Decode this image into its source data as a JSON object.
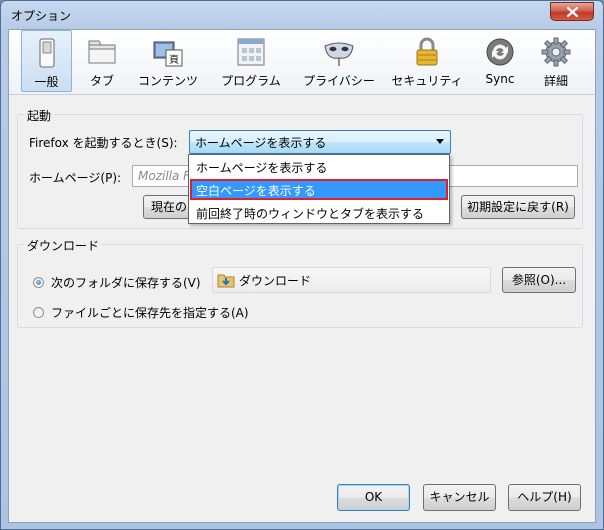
{
  "window": {
    "title": "オプション"
  },
  "toolbar": {
    "items": [
      {
        "label": "一般",
        "icon": "switch-icon",
        "selected": true
      },
      {
        "label": "タブ",
        "icon": "tabs-icon"
      },
      {
        "label": "コンテンツ",
        "icon": "content-icon"
      },
      {
        "label": "プログラム",
        "icon": "applications-icon"
      },
      {
        "label": "プライバシー",
        "icon": "privacy-mask-icon"
      },
      {
        "label": "セキュリティ",
        "icon": "padlock-icon"
      },
      {
        "label": "Sync",
        "icon": "sync-icon"
      },
      {
        "label": "詳細",
        "icon": "gear-icon"
      }
    ]
  },
  "startup": {
    "group_label": "起動",
    "when_label": "Firefox を起動するとき(S):",
    "selected_value": "ホームページを表示する",
    "homepage_label": "ホームページ(P):",
    "homepage_placeholder": "Mozilla F",
    "use_current_label": "現在の",
    "restore_default_label": "初期設定に戻す(R)",
    "dropdown_options": [
      "ホームページを表示する",
      "空白ページを表示する",
      "前回終了時のウィンドウとタブを表示する"
    ]
  },
  "downloads": {
    "group_label": "ダウンロード",
    "save_to_label": "次のフォルダに保存する(V)",
    "folder_name": "ダウンロード",
    "browse_label": "参照(O)...",
    "ask_label": "ファイルごとに保存先を指定する(A)"
  },
  "footer": {
    "ok_label": "OK",
    "cancel_label": "キャンセル",
    "help_label": "ヘルプ(H)"
  },
  "colors": {
    "selection": "#3399ff",
    "highlight_border": "#e0202a",
    "close_button": "#c0392b"
  }
}
